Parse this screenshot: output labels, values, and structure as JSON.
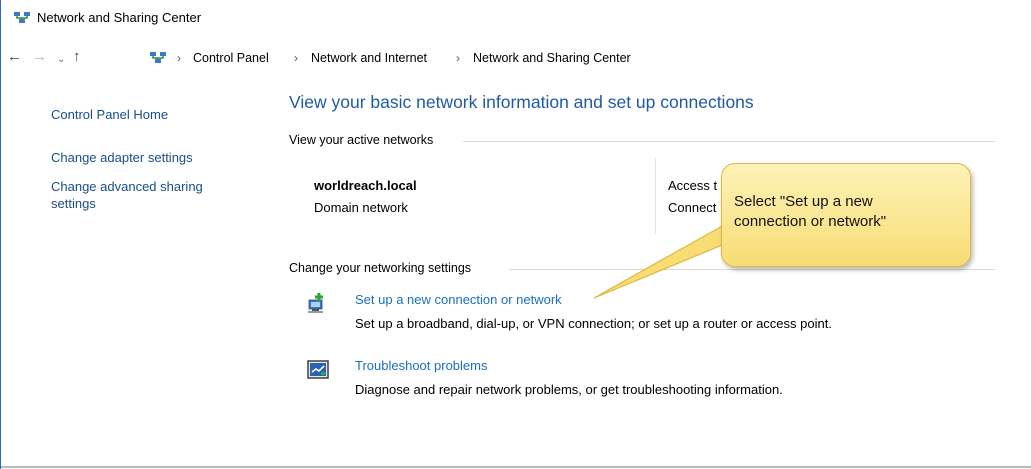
{
  "window": {
    "title": "Network and Sharing Center"
  },
  "nav": {
    "back_icon": "arrow-left-icon",
    "forward_icon": "arrow-right-icon",
    "recent_icon": "chevron-down-icon",
    "up_icon": "arrow-up-icon",
    "breadcrumbs": [
      "Control Panel",
      "Network and Internet",
      "Network and Sharing Center"
    ],
    "separator": "›"
  },
  "sidebar": {
    "items": [
      {
        "label": "Control Panel Home"
      },
      {
        "label": "Change adapter settings"
      },
      {
        "label": "Change advanced sharing\nsettings"
      }
    ]
  },
  "main": {
    "title": "View your basic network information and set up connections",
    "active_networks_header": "View your active networks",
    "network": {
      "name": "worldreach.local",
      "type": "Domain network",
      "access_label": "Access t",
      "connections_label": "Connect"
    },
    "change_settings_header": "Change your networking settings",
    "tasks": [
      {
        "label": "Set up a new connection or network",
        "description": "Set up a broadband, dial-up, or VPN connection; or set up a router or access point.",
        "icon": "new-connection-icon"
      },
      {
        "label": "Troubleshoot problems",
        "description": "Diagnose and repair network problems, or get troubleshooting information.",
        "icon": "troubleshoot-icon"
      }
    ]
  },
  "callout": {
    "text": "Select \"Set up a new\nconnection or network\""
  },
  "colors": {
    "link": "#1a6fc4",
    "title": "#1e5aa8",
    "callout_fill": "#f8dc74",
    "callout_border": "#e2b544"
  }
}
